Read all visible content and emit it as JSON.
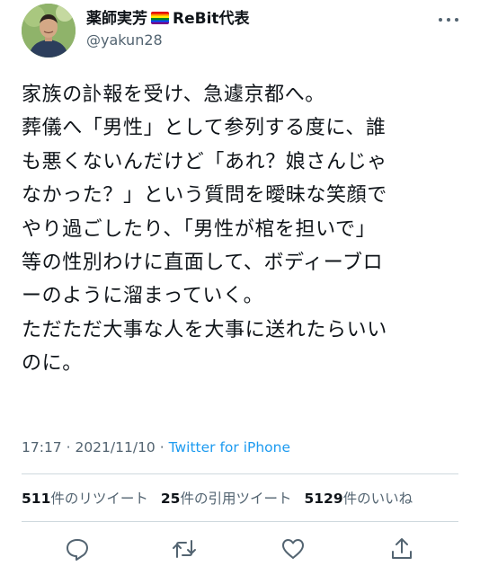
{
  "author": {
    "display_name": "薬師実芳",
    "display_suffix": "ReBit代表",
    "handle": "@yakun28"
  },
  "tweet": {
    "lines": [
      "家族の訃報を受け、急遽京都へ。",
      "葬儀へ「男性」として参列する度に、誰",
      "も悪くないんだけど「あれ？娘さんじゃ",
      "なかった？」という質問を曖昧な笑顔で",
      "やり過ごしたり、「男性が棺を担いで」",
      "等の性別わけに直面して、ボディーブロ",
      "ーのように溜まっていく。",
      "ただただ大事な人を大事に送れたらいい",
      "のに。"
    ]
  },
  "meta": {
    "time": "17:17",
    "separator": " · ",
    "date": "2021/11/10",
    "source": "Twitter for iPhone"
  },
  "stats": {
    "retweets": {
      "count": "511",
      "label": "件のリツイート"
    },
    "quotes": {
      "count": "25",
      "label": "件の引用ツイート"
    },
    "likes": {
      "count": "5129",
      "label": "件のいいね"
    }
  },
  "icons": {
    "more": "more-icon",
    "reply": "reply-icon",
    "retweet": "retweet-icon",
    "like": "like-icon",
    "share": "share-icon",
    "flag": "rainbow-flag-icon"
  },
  "colors": {
    "text": "#0f1419",
    "muted": "#536471",
    "link": "#1d9bf0",
    "divider": "#cfd9de"
  }
}
